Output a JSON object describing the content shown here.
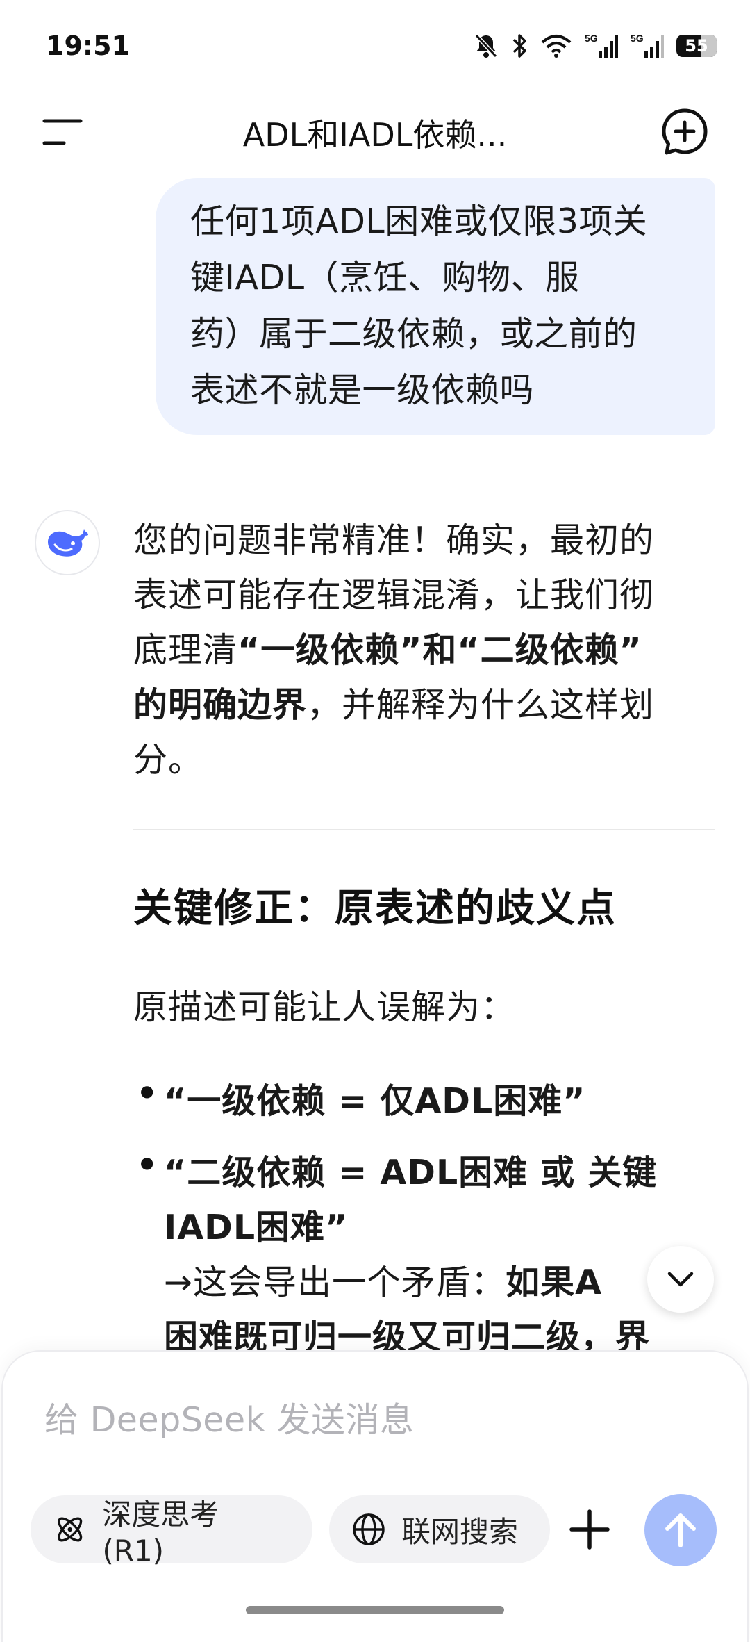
{
  "status_bar": {
    "time": "19:51",
    "battery": "55"
  },
  "header": {
    "title": "ADL和IADL依赖..."
  },
  "user_message": {
    "lines": [
      "任何1项ADL困难或仅限3项关",
      "键IADL（烹饪、购物、服",
      "药）属于二级依赖，或之前的",
      "表述不就是一级依赖吗"
    ]
  },
  "assistant_message": {
    "intro_1": "您的问题非常精准！确实，最初的",
    "intro_2": "表述可能存在逻辑混淆，让我们彻",
    "intro_3a": "底理清",
    "intro_3b": "“一级依赖”和“二级依赖”",
    "intro_4a": "的明确边界",
    "intro_4b": "，并解释为什么这样划",
    "intro_5": "分。",
    "heading": "关键修正：原表述的歧义点",
    "paragraph": "原描述可能让人误解为：",
    "bullet_symbol": "•",
    "bullet_1": "“一级依赖 = 仅ADL困难”",
    "bullet_2a": "“二级依赖 = ADL困难 或 关键",
    "bullet_2b": "IADL困难”",
    "bullet_2c_plain": "→这会导出一个矛盾：",
    "bullet_2c_bold": "如果A",
    "bullet_2d": "困难既可归一级又可归二级，界"
  },
  "composer": {
    "placeholder": "给 DeepSeek 发送消息",
    "deep_think_label": "深度思考 (R1)",
    "web_search_label": "联网搜索"
  },
  "colors": {
    "accent": "#4d6bfe",
    "send_disabled": "#a6bdfb",
    "bubble": "#edf2fe"
  }
}
